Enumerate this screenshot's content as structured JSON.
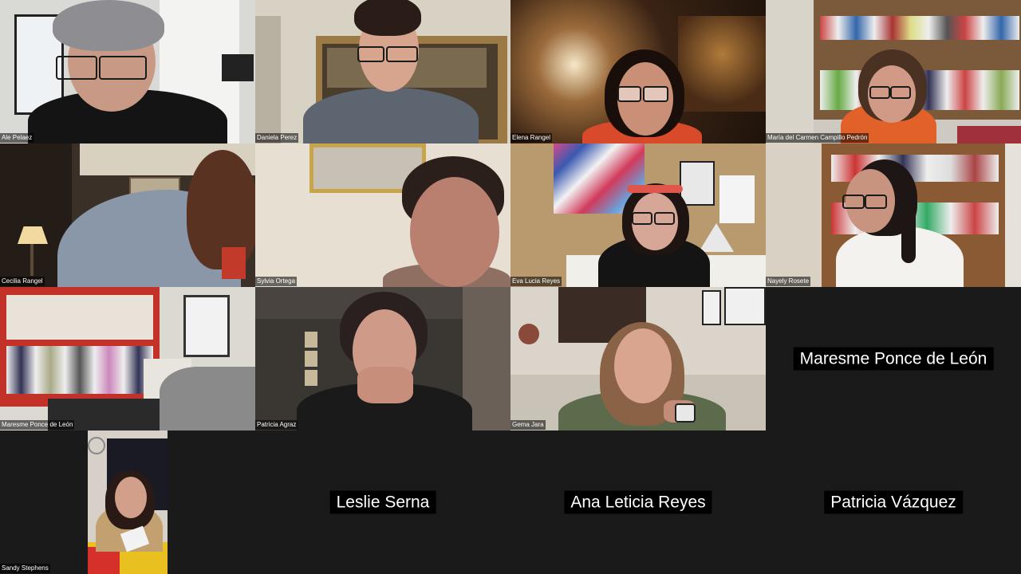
{
  "meeting": {
    "participants": [
      {
        "id": "ale",
        "name": "Ale Pelaez"
      },
      {
        "id": "daniela",
        "name": "Daniela Perez"
      },
      {
        "id": "elena",
        "name": "Elena Rangel"
      },
      {
        "id": "maria",
        "name": "María del Carmen Campillo Pedrón"
      },
      {
        "id": "cecilia",
        "name": "Cecilia Rangel"
      },
      {
        "id": "sylvia",
        "name": "Sylvia Ortega"
      },
      {
        "id": "eva",
        "name": "Eva Lucia Reyes"
      },
      {
        "id": "nayely",
        "name": "Nayely Rosete"
      },
      {
        "id": "maresme_video",
        "name": "Maresme Ponce de León"
      },
      {
        "id": "patricia_agraz",
        "name": "Patricia Agraz"
      },
      {
        "id": "gema",
        "name": "Gema Jara"
      },
      {
        "id": "maresme_center",
        "name": "Maresme Ponce de León"
      },
      {
        "id": "sandy",
        "name": "Sandy Stephens"
      },
      {
        "id": "leslie",
        "name": "Leslie Serna"
      },
      {
        "id": "ana",
        "name": "Ana Leticia Reyes"
      },
      {
        "id": "patricia_v",
        "name": "Patricia Vázquez"
      }
    ]
  }
}
